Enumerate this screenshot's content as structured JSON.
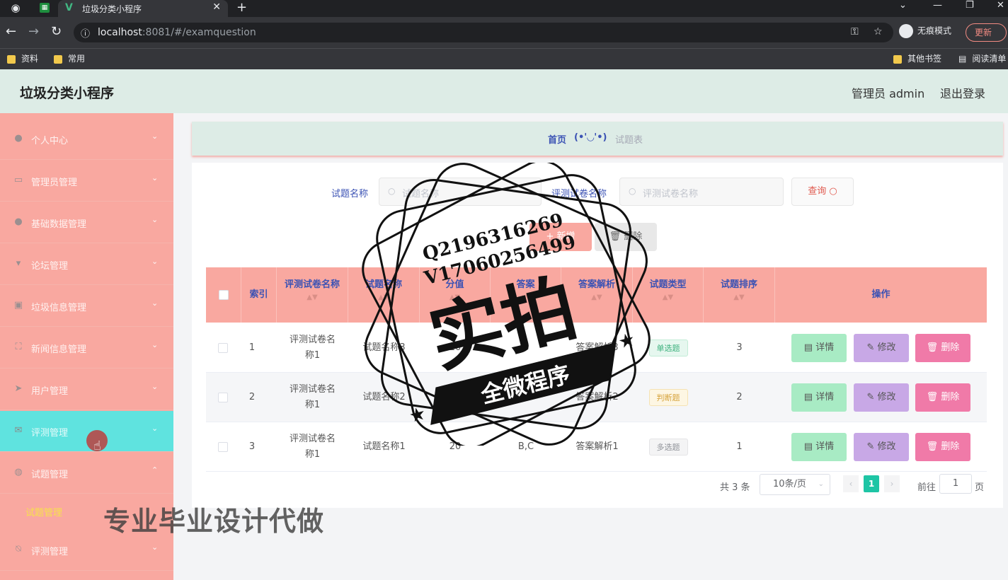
{
  "browser": {
    "tab_title": "垃圾分类小程序",
    "url_host": "localhost",
    "url_rest": ":8081/#/examquestion",
    "incognito_label": "无痕模式",
    "update_label": "更新",
    "bookmarks": [
      "资料",
      "常用"
    ],
    "bookmarks_right": [
      "其他书签",
      "阅读清单"
    ]
  },
  "header": {
    "title": "垃圾分类小程序",
    "admin": "管理员 admin",
    "logout": "退出登录"
  },
  "sidebar": {
    "items": [
      {
        "label": "个人中心",
        "icon": "user-icon"
      },
      {
        "label": "管理员管理",
        "icon": "id-card-icon"
      },
      {
        "label": "基础数据管理",
        "icon": "user-icon"
      },
      {
        "label": "论坛管理",
        "icon": "trophy-icon"
      },
      {
        "label": "垃圾信息管理",
        "icon": "trash-icon"
      },
      {
        "label": "新闻信息管理",
        "icon": "frame-icon"
      },
      {
        "label": "用户管理",
        "icon": "send-icon"
      },
      {
        "label": "评测管理",
        "icon": "mail-icon"
      },
      {
        "label": "试题管理",
        "icon": "globe-icon"
      },
      {
        "label": "评测管理",
        "icon": "bell-off-icon"
      }
    ],
    "submenu_label": "试题管理"
  },
  "breadcrumb": {
    "home": "首页",
    "separator": "(•'◡'•)",
    "current": "试题表"
  },
  "search": {
    "name_label": "试题名称",
    "name_placeholder": "试题名称",
    "paper_label": "评测试卷名称",
    "paper_placeholder": "评测试卷名称",
    "query_button": "查询"
  },
  "actions": {
    "add": "新增",
    "delete": "删除"
  },
  "table": {
    "columns": [
      "索引",
      "评测试卷名称",
      "试题名称",
      "分值",
      "答案",
      "答案解析",
      "试题类型",
      "试题排序",
      "操作"
    ],
    "rows": [
      {
        "index": "1",
        "paper": "评测试卷名称1",
        "name": "试题名称3",
        "score": "20",
        "answer": "B",
        "analysis": "答案解析3",
        "type": "单选题",
        "order": "3"
      },
      {
        "index": "2",
        "paper": "评测试卷名称1",
        "name": "试题名称2",
        "score": "20",
        "answer": "A",
        "analysis": "答案解析2",
        "type": "判断题",
        "order": "2"
      },
      {
        "index": "3",
        "paper": "评测试卷名称1",
        "name": "试题名称1",
        "score": "20",
        "answer": "B,C",
        "analysis": "答案解析1",
        "type": "多选题",
        "order": "1"
      }
    ],
    "row_actions": {
      "detail": "详情",
      "edit": "修改",
      "remove": "删除"
    }
  },
  "pagination": {
    "total": "共 3 条",
    "page_size": "10条/页",
    "current_page": "1",
    "goto_prefix": "前往",
    "goto_value": "1",
    "goto_suffix": "页"
  },
  "watermark": {
    "line1": "Q2196316269",
    "line2": "V17060256499",
    "big": "实拍",
    "ribbon": "全微程序",
    "bottom": "专业毕业设计代做"
  },
  "colors": {
    "sidebar_bg": "#f9a8a0",
    "sidebar_active": "#5fe3df",
    "header_bg": "#ddece6",
    "accent_blue": "#3b52b4",
    "page_active": "#1ec5a5"
  }
}
